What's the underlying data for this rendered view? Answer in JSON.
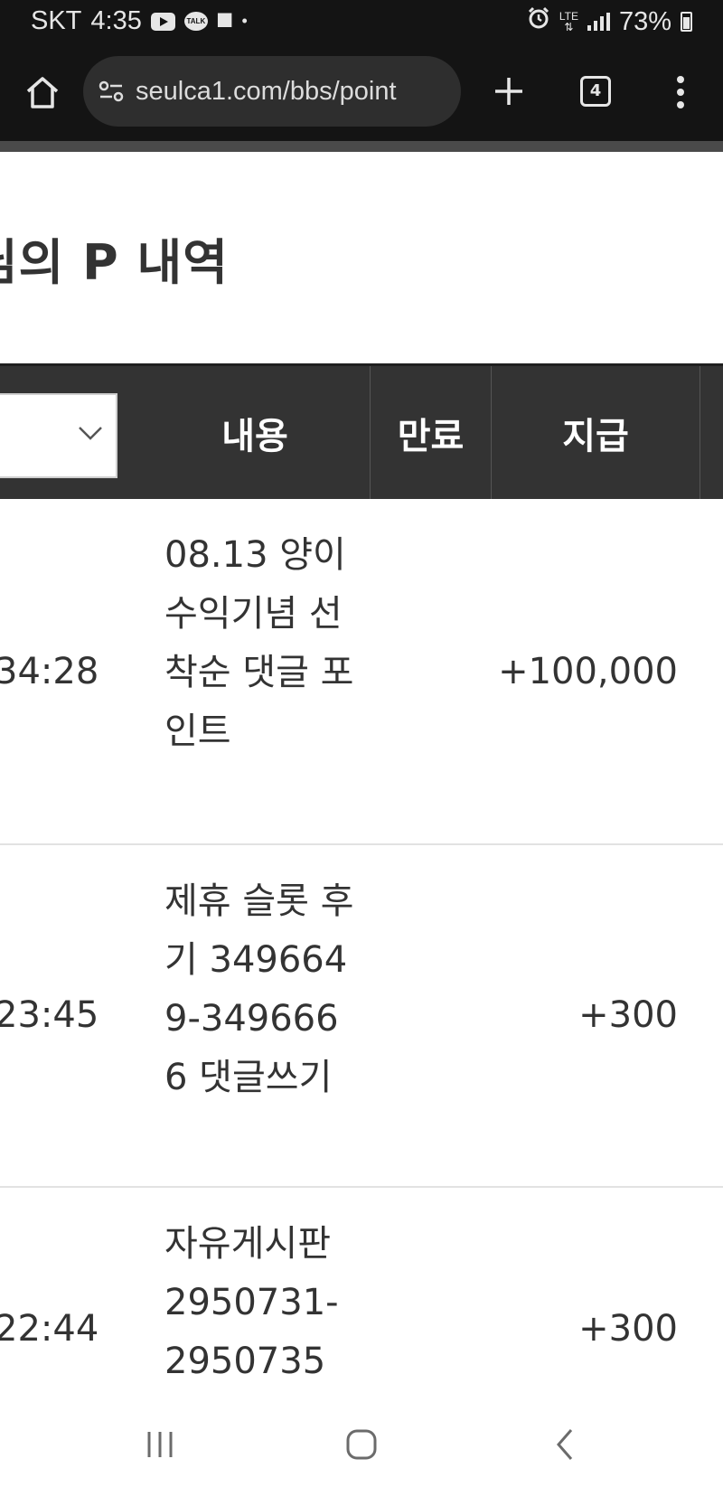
{
  "status_bar": {
    "carrier": "SKT",
    "time": "4:35",
    "notification_icons": [
      "youtube-icon",
      "kakaotalk-icon",
      "game-controller-icon",
      "dot-icon"
    ],
    "right_icons": [
      "alarm-icon",
      "lte-icon",
      "signal-icon"
    ],
    "lte_label": "LTE",
    "battery": "73%"
  },
  "browser": {
    "url": "seulca1.com/bbs/point",
    "tab_count": "4",
    "icons": [
      "home-icon",
      "site-settings-icon",
      "plus-icon",
      "tabs-icon",
      "more-vertical-icon"
    ]
  },
  "page": {
    "title": "님의 P 내역"
  },
  "table": {
    "headers": {
      "content": "내용",
      "expire": "만료",
      "paid": "지급"
    },
    "rows": [
      {
        "time": "34:28",
        "content": "08.13 양이 수익기념 선착순 댓글 포인트",
        "amount": "+100,000"
      },
      {
        "time": "23:45",
        "content": "제휴 슬롯 후기 3496649-3496666 댓글쓰기",
        "amount": "+300"
      },
      {
        "time": "22:44",
        "content": "자유게시판 2950731-2950735",
        "amount": "+300"
      }
    ]
  },
  "nav_bar": {
    "icons": [
      "recent-apps-icon",
      "home-circle-icon",
      "back-icon"
    ]
  },
  "colors": {
    "status_bg": "#141414",
    "url_bar_bg": "#2e2e2e",
    "table_header_bg": "#333333",
    "text": "#333333"
  }
}
